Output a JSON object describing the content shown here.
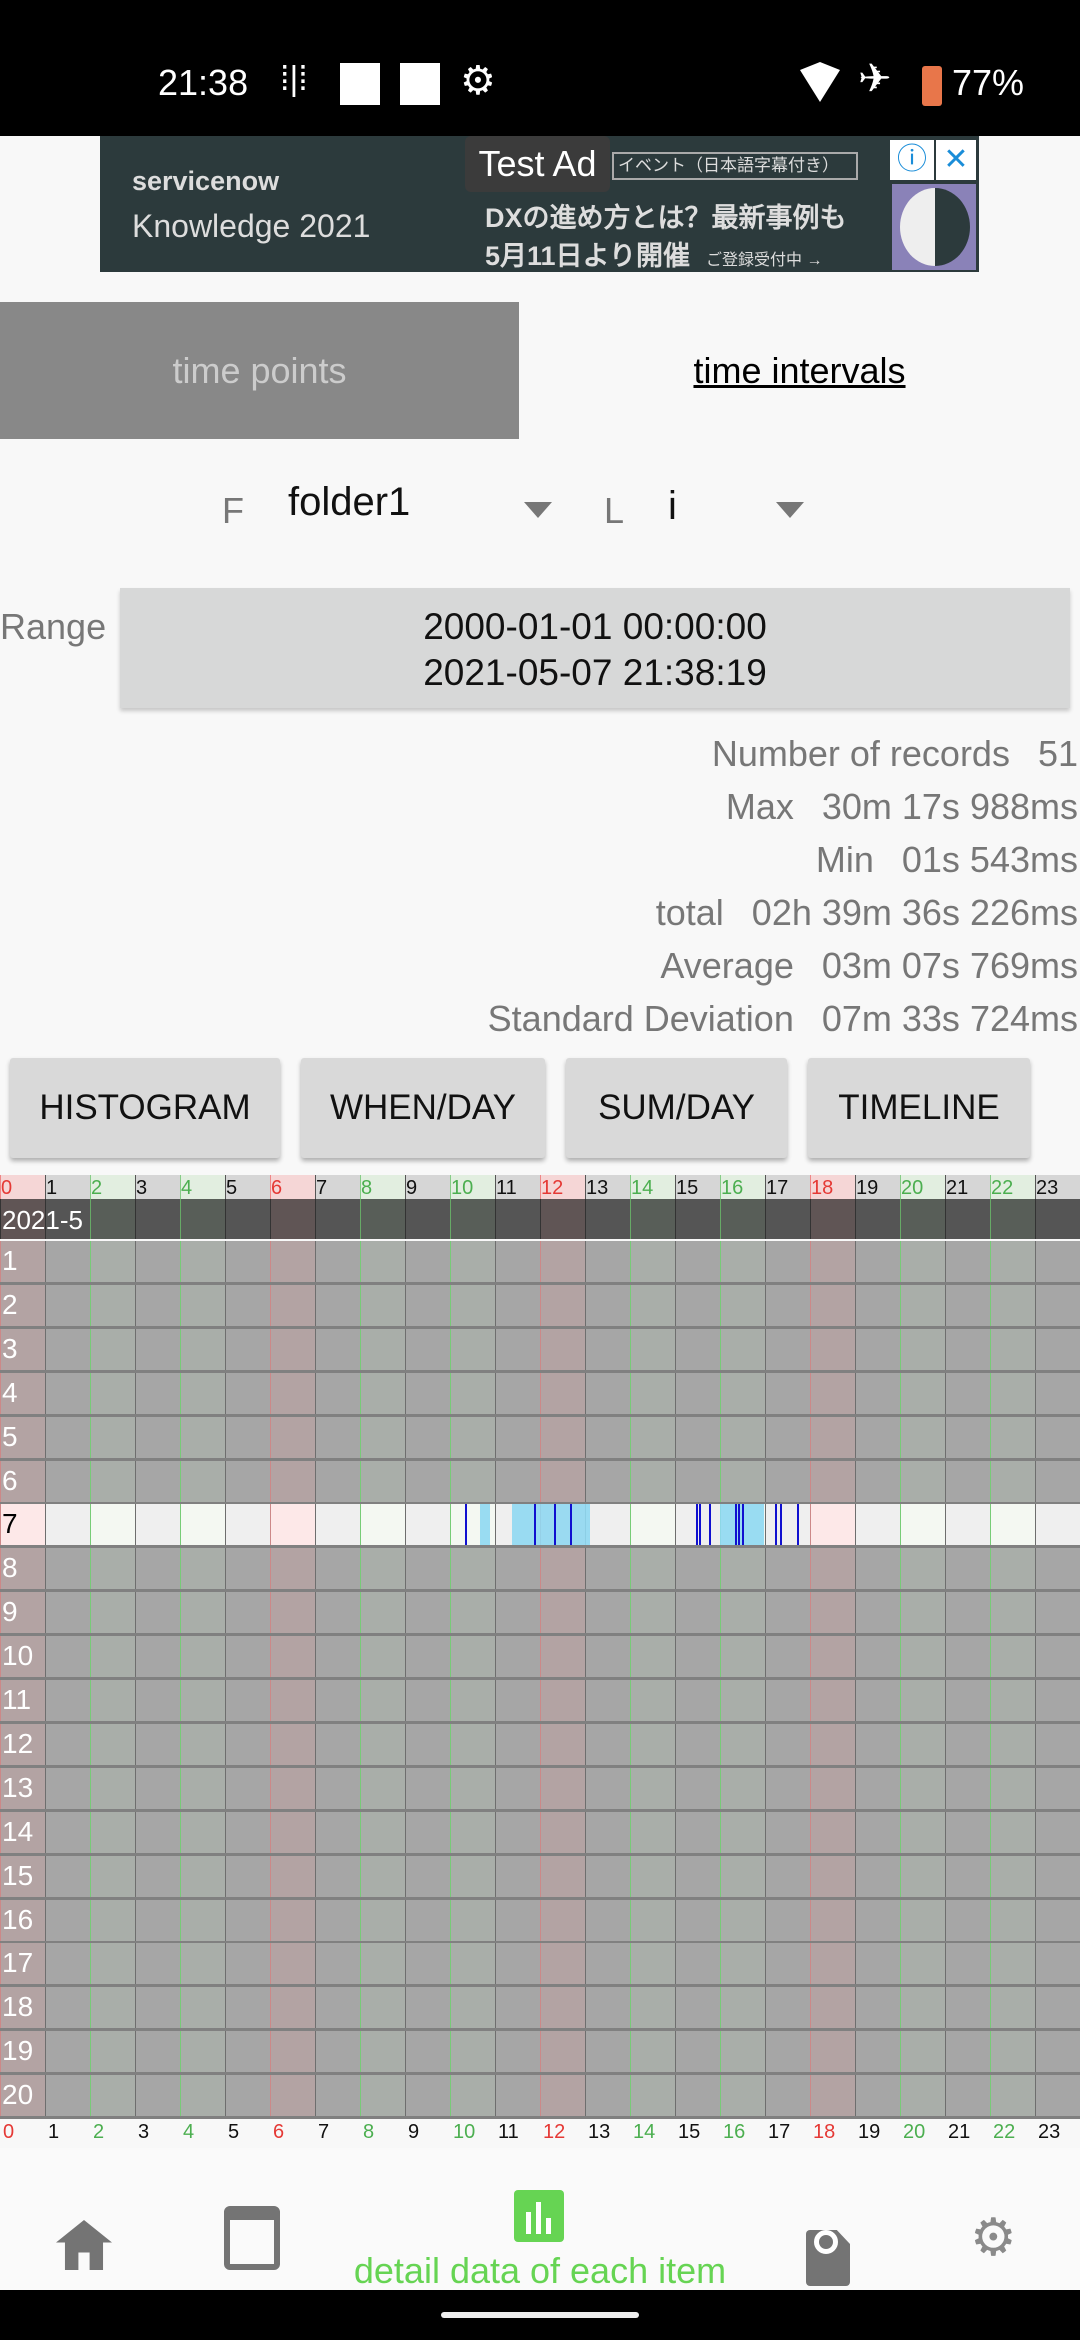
{
  "status_bar": {
    "time": "21:38",
    "battery": "77%",
    "icons": [
      "podcast-icon",
      "square-icon",
      "square-icon",
      "gear-icon",
      "wifi-icon",
      "airplane-icon",
      "battery-saver-icon"
    ]
  },
  "ad": {
    "badge": "Test Ad",
    "brand": "servicenow",
    "title": "Knowledge 2021",
    "tagline": "イベント（日本語字幕付き）",
    "line1": "DXの進め方とは？最新事例も",
    "line2": "5月11日より開催",
    "line2_small": "ご登録受付中 →",
    "info": "ⓘ",
    "close": "✕"
  },
  "tabs": [
    {
      "label": "time points",
      "active": false
    },
    {
      "label": "time intervals",
      "active": true
    }
  ],
  "filters": {
    "folder_label": "F",
    "folder_value": "folder1",
    "list_label": "L",
    "list_value": "i"
  },
  "range": {
    "label": "Range",
    "start": "2000-01-01 00:00:00",
    "end": "2021-05-07 21:38:19"
  },
  "stats": [
    {
      "label": "Number of records",
      "value": "51"
    },
    {
      "label": "Max",
      "value": "30m 17s 988ms"
    },
    {
      "label": "Min",
      "value": "01s 543ms"
    },
    {
      "label": "total",
      "value": "02h 39m 36s 226ms"
    },
    {
      "label": "Average",
      "value": "03m 07s 769ms"
    },
    {
      "label": "Standard Deviation",
      "value": "07m 33s 724ms"
    }
  ],
  "buttons": [
    "HISTOGRAM",
    "WHEN/DAY",
    "SUM/DAY",
    "TIMELINE"
  ],
  "grid": {
    "hours": [
      "0",
      "1",
      "2",
      "3",
      "4",
      "5",
      "6",
      "7",
      "8",
      "9",
      "10",
      "11",
      "12",
      "13",
      "14",
      "15",
      "16",
      "17",
      "18",
      "19",
      "20",
      "21",
      "22",
      "23"
    ],
    "month": "2021-5",
    "days": [
      "1",
      "2",
      "3",
      "4",
      "5",
      "6",
      "7",
      "8",
      "9",
      "10",
      "11",
      "12",
      "13",
      "14",
      "15",
      "16",
      "17",
      "18",
      "19",
      "20"
    ],
    "highlighted_day": "7",
    "colors": {
      "red_hour": "#e53935",
      "green_hour": "#4caf50",
      "interval_fill": "#8fd8f2",
      "interval_edge": "#1010d0"
    },
    "intervals_day7": [
      [
        "10:20",
        "10:21"
      ],
      [
        "10:40",
        "10:53"
      ],
      [
        "11:23",
        "13:07"
      ],
      [
        "11:52",
        "11:53"
      ],
      [
        "12:19",
        "12:20"
      ],
      [
        "12:40",
        "12:41"
      ],
      [
        "15:28",
        "15:29"
      ],
      [
        "15:32",
        "15:33"
      ],
      [
        "15:45",
        "15:46"
      ],
      [
        "16:00",
        "16:59"
      ],
      [
        "16:20",
        "16:21"
      ],
      [
        "16:24",
        "16:25"
      ],
      [
        "16:29",
        "16:30"
      ],
      [
        "17:13",
        "17:14"
      ],
      [
        "17:20",
        "17:21"
      ],
      [
        "17:43",
        "17:44"
      ]
    ]
  },
  "bottom_nav": [
    {
      "icon": "home-icon",
      "label": ""
    },
    {
      "icon": "calendar-icon",
      "label": ""
    },
    {
      "icon": "bar-chart-icon",
      "label": "detail data of each item",
      "active": true,
      "color": "#66d453"
    },
    {
      "icon": "file-search-icon",
      "label": ""
    },
    {
      "icon": "gear-icon",
      "label": ""
    }
  ]
}
